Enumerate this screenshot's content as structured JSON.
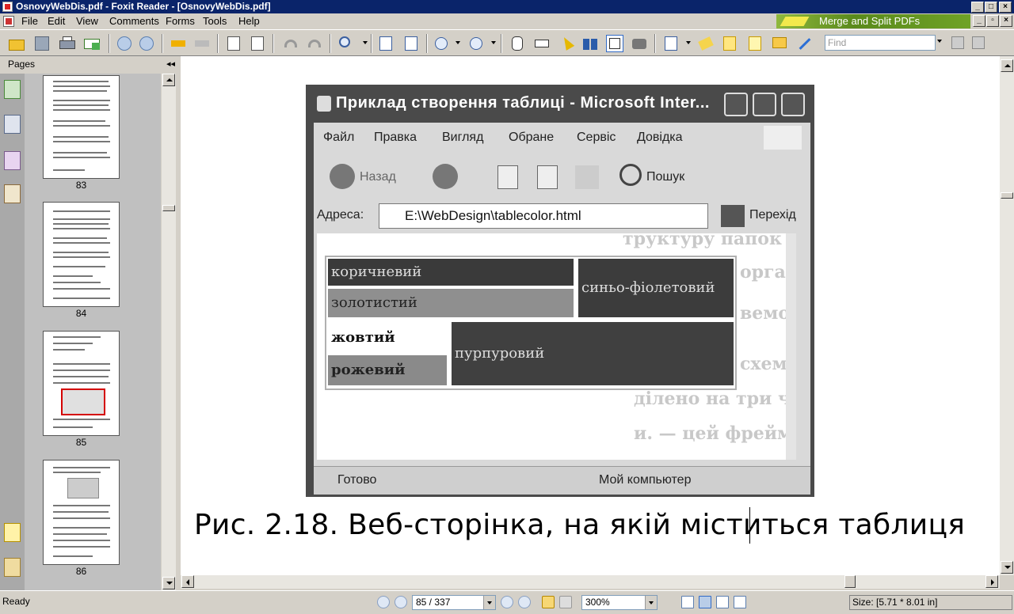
{
  "window": {
    "title": "OsnovyWebDis.pdf - Foxit Reader - [OsnovyWebDis.pdf]"
  },
  "menu": {
    "items": [
      "File",
      "Edit",
      "View",
      "Comments",
      "Forms",
      "Tools",
      "Help"
    ]
  },
  "banner": {
    "text": "Merge and Split PDFs"
  },
  "toolbar": {
    "find_placeholder": "Find"
  },
  "sidebar": {
    "tab_label": "Pages",
    "collapse_glyph": "◂◂",
    "thumbnails": [
      {
        "page": "83"
      },
      {
        "page": "84"
      },
      {
        "page": "85"
      },
      {
        "page": "86"
      }
    ]
  },
  "document": {
    "screenshot": {
      "window_title": "Приклад створення таблиці - Microsoft Inter...",
      "menu": [
        "Файл",
        "Правка",
        "Вигляд",
        "Обране",
        "Сервіс",
        "Довідка"
      ],
      "back_label": "Назад",
      "search_label": "Пошук",
      "address_label": "Адреса:",
      "address_value": "E:\\WebDesign\\tablecolor.html",
      "go_label": "Перехід",
      "cells": {
        "brown": "коричневий",
        "gold": "золотистий",
        "blueviolet": "синьо-фіолетовий",
        "yellow": "жовтий",
        "pink": "рожевий",
        "purple": "пурпуровий"
      },
      "status_left": "Готово",
      "status_right": "Мой компьютер",
      "background_text": [
        "труктуру папок для веб-сайту та",
        "орга",
        "вемо",
        "схем",
        "ділено на три частини. У верх",
        "и. — цей фрейм не буде енонлює"
      ]
    },
    "caption": "Рис. 2.18. Веб-сторінка, на якій міститься таблиця"
  },
  "statusbar": {
    "ready": "Ready",
    "page_indicator": "85 / 337",
    "zoom": "300%",
    "size": "Size: [5.71 * 8.01 in]"
  },
  "colors": {
    "titlebar": "#0a246a",
    "chrome": "#d4d0c8",
    "thumb_highlight": "#d40000",
    "banner_green": "#6fa226"
  }
}
